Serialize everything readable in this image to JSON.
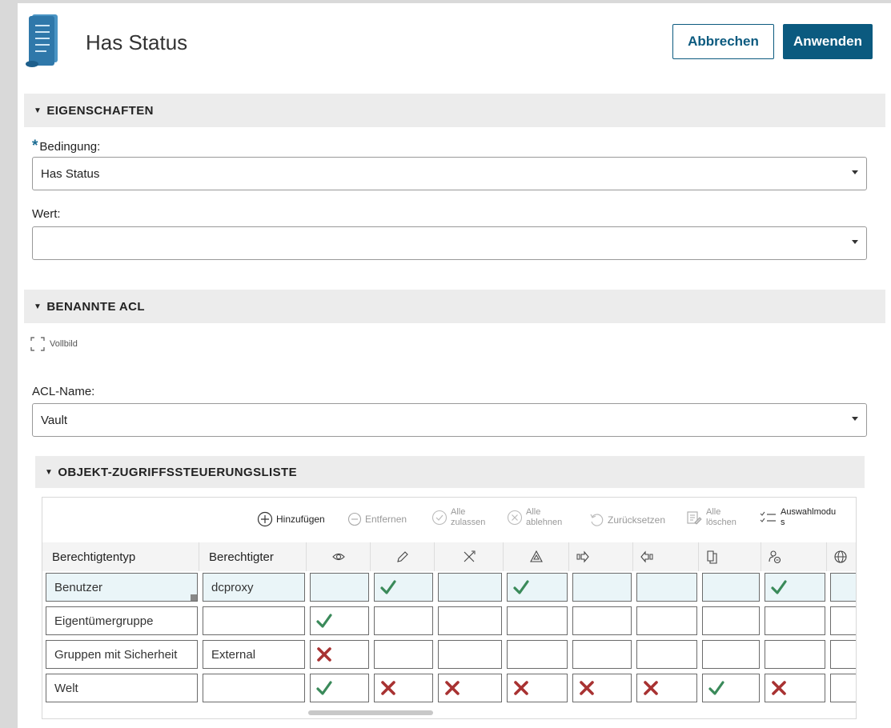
{
  "header": {
    "title": "Has Status",
    "cancel_label": "Abbrechen",
    "apply_label": "Anwenden"
  },
  "properties": {
    "section_title": "EIGENSCHAFTEN",
    "condition_label": "Bedingung:",
    "condition_value": "Has Status",
    "value_label": "Wert:",
    "value_value": ""
  },
  "named_acl": {
    "section_title": "BENANNTE ACL",
    "fullscreen_label": "Vollbild",
    "acl_name_label": "ACL-Name:",
    "acl_name_value": "Vault"
  },
  "object_acl": {
    "section_title": "OBJEKT-ZUGRIFFSSTEUERUNGSLISTE",
    "toolbar": {
      "add": "Hinzufügen",
      "remove": "Entfernen",
      "allow_all_1": "Alle",
      "allow_all_2": "zulassen",
      "deny_all_1": "Alle",
      "deny_all_2": "ablehnen",
      "reset": "Zurücksetzen",
      "clear_all_1": "Alle",
      "clear_all_2": "löschen",
      "select_mode_1": "Auswahlmodu",
      "select_mode_2": "s"
    },
    "columns": {
      "type": "Berechtigtentyp",
      "grantee": "Berechtigter",
      "permission_icons": [
        "eye-icon",
        "pencil-icon",
        "tools-icon",
        "warning-icon",
        "move-out-icon",
        "move-in-icon",
        "copy-icon",
        "owner-change-icon",
        "globe-icon"
      ]
    },
    "rows": [
      {
        "type": "Benutzer",
        "grantee": "dcproxy",
        "perms": [
          "",
          "allow",
          "",
          "allow",
          "",
          "",
          "",
          "allow",
          ""
        ]
      },
      {
        "type": "Eigentümergruppe",
        "grantee": "",
        "perms": [
          "allow",
          "",
          "",
          "",
          "",
          "",
          "",
          "",
          ""
        ]
      },
      {
        "type": "Gruppen mit Sicherheit",
        "grantee": "External",
        "perms": [
          "deny",
          "",
          "",
          "",
          "",
          "",
          "",
          "",
          ""
        ]
      },
      {
        "type": "Welt",
        "grantee": "",
        "perms": [
          "allow",
          "deny",
          "deny",
          "deny",
          "deny",
          "deny",
          "allow",
          "deny",
          ""
        ]
      }
    ]
  },
  "colors": {
    "primary": "#0b5a7f",
    "allow": "#3a8a5a",
    "deny": "#a83232",
    "section_bg": "#ececec",
    "selected_row": "#eaf5f8"
  }
}
